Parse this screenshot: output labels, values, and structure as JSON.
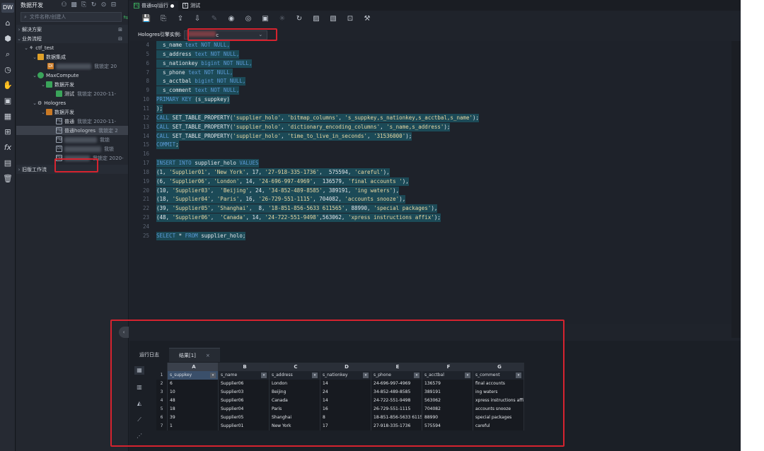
{
  "app": {
    "title": "数据开发",
    "logo_text": "DW"
  },
  "rail_icons": [
    "home-icon",
    "cube-icon",
    "search-icon",
    "clock-icon",
    "hand-icon",
    "briefcase-icon",
    "table-icon",
    "grid-icon",
    "function-icon",
    "terminal-icon",
    "trash-icon"
  ],
  "tree": {
    "search_placeholder": "文件名称/创建人",
    "items": [
      {
        "label": "解决方案",
        "meta": ""
      },
      {
        "label": "业务流程",
        "meta": ""
      },
      {
        "label": "ctf_test",
        "meta": ""
      },
      {
        "label": "数据集成",
        "meta": ""
      },
      {
        "label": "",
        "meta": "我锁定  20"
      },
      {
        "label": "MaxCompute",
        "meta": ""
      },
      {
        "label": "数据开发",
        "meta": ""
      },
      {
        "label": "测试",
        "meta": "我锁定  2020-11-"
      },
      {
        "label": "Hologres",
        "meta": ""
      },
      {
        "label": "数据开发",
        "meta": ""
      },
      {
        "label": "普通",
        "meta": "我锁定  2020-11-"
      },
      {
        "label": "普通hologres",
        "meta": "我锁定  2"
      },
      {
        "label": "",
        "meta": "我锁"
      },
      {
        "label": "",
        "meta": "我锁"
      },
      {
        "label": "",
        "meta": "我锁定  2020-"
      },
      {
        "label": "旧版工作流",
        "meta": ""
      }
    ]
  },
  "tabs": [
    {
      "label": "普通sql运行",
      "active": true
    },
    {
      "label": "测试",
      "active": false
    }
  ],
  "engine": {
    "label": "Hologres引擎实例:",
    "value": "c"
  },
  "code_lines": [
    {
      "n": "4",
      "tokens": [
        [
          "tx",
          "  s_name "
        ],
        [
          "kw",
          "text NOT NULL,"
        ]
      ],
      "hl": true
    },
    {
      "n": "5",
      "tokens": [
        [
          "tx",
          "  s_address "
        ],
        [
          "kw",
          "text NOT NULL,"
        ]
      ],
      "hl": true
    },
    {
      "n": "6",
      "tokens": [
        [
          "tx",
          "  s_nationkey "
        ],
        [
          "kw",
          "bigint NOT NULL,"
        ]
      ],
      "hl": true
    },
    {
      "n": "7",
      "tokens": [
        [
          "tx",
          "  s_phone "
        ],
        [
          "kw",
          "text NOT NULL,"
        ]
      ],
      "hl": true
    },
    {
      "n": "8",
      "tokens": [
        [
          "tx",
          "  s_acctbal "
        ],
        [
          "kw",
          "bigint NOT NULL,"
        ]
      ],
      "hl": true
    },
    {
      "n": "9",
      "tokens": [
        [
          "tx",
          "  s_comment "
        ],
        [
          "kw",
          "text NOT NULL,"
        ]
      ],
      "hl": true
    },
    {
      "n": "10",
      "tokens": [
        [
          "kw",
          "PRIMARY KEY "
        ],
        [
          "tx",
          "(s_suppkey)"
        ]
      ],
      "hl": true
    },
    {
      "n": "11",
      "tokens": [
        [
          "tx",
          ");"
        ]
      ],
      "hl": true
    },
    {
      "n": "12",
      "tokens": [
        [
          "kw",
          "CALL "
        ],
        [
          "tx",
          "SET_TABLE_PROPERTY("
        ],
        [
          "st",
          "'supplier_holo'"
        ],
        [
          "tx",
          ", "
        ],
        [
          "st",
          "'bitmap_columns'"
        ],
        [
          "tx",
          ", "
        ],
        [
          "st",
          "'s_suppkey,s_nationkey,s_acctbal,s_name'"
        ],
        [
          "tx",
          ");"
        ]
      ],
      "hl": true
    },
    {
      "n": "13",
      "tokens": [
        [
          "kw",
          "CALL "
        ],
        [
          "tx",
          "SET_TABLE_PROPERTY("
        ],
        [
          "st",
          "'supplier_holo'"
        ],
        [
          "tx",
          ", "
        ],
        [
          "st",
          "'dictionary_encoding_columns'"
        ],
        [
          "tx",
          ", "
        ],
        [
          "st",
          "'s_name,s_address'"
        ],
        [
          "tx",
          ");"
        ]
      ],
      "hl": true
    },
    {
      "n": "14",
      "tokens": [
        [
          "kw",
          "CALL "
        ],
        [
          "tx",
          "SET_TABLE_PROPERTY("
        ],
        [
          "st",
          "'supplier_holo'"
        ],
        [
          "tx",
          ", "
        ],
        [
          "st",
          "'time_to_live_in_seconds'"
        ],
        [
          "tx",
          ", "
        ],
        [
          "st",
          "'31536000'"
        ],
        [
          "tx",
          ");"
        ]
      ],
      "hl": true
    },
    {
      "n": "15",
      "tokens": [
        [
          "kw",
          "COMMIT"
        ],
        [
          "tx",
          ";"
        ]
      ],
      "hl": true
    },
    {
      "n": "16",
      "tokens": [],
      "hl": true
    },
    {
      "n": "17",
      "tokens": [
        [
          "kw",
          "INSERT INTO "
        ],
        [
          "tx",
          "supplier_holo "
        ],
        [
          "kw",
          "VALUES"
        ]
      ],
      "hl": true
    },
    {
      "n": "18",
      "tokens": [
        [
          "tx",
          "(1, "
        ],
        [
          "st",
          "'Supplier01'"
        ],
        [
          "tx",
          ", "
        ],
        [
          "st",
          "'New York'"
        ],
        [
          "tx",
          ", 17, "
        ],
        [
          "st",
          "'27-918-335-1736'"
        ],
        [
          "tx",
          ",  575594, "
        ],
        [
          "st",
          "'careful'"
        ],
        [
          "tx",
          "),"
        ]
      ],
      "hl": true
    },
    {
      "n": "19",
      "tokens": [
        [
          "tx",
          "(6, "
        ],
        [
          "st",
          "'Supplier06'"
        ],
        [
          "tx",
          ", "
        ],
        [
          "st",
          "'London'"
        ],
        [
          "tx",
          ", 14, "
        ],
        [
          "st",
          "'24-696-997-4969'"
        ],
        [
          "tx",
          ",  136579, "
        ],
        [
          "st",
          "'final accounts '"
        ],
        [
          "tx",
          "),"
        ]
      ],
      "hl": true
    },
    {
      "n": "20",
      "tokens": [
        [
          "tx",
          "(10, "
        ],
        [
          "st",
          "'Supplier03'"
        ],
        [
          "tx",
          ",  "
        ],
        [
          "st",
          "'Beijing'"
        ],
        [
          "tx",
          ", 24, "
        ],
        [
          "st",
          "'34-852-489-8585'"
        ],
        [
          "tx",
          ", 389191, "
        ],
        [
          "st",
          "'ing waters'"
        ],
        [
          "tx",
          "),"
        ]
      ],
      "hl": true
    },
    {
      "n": "21",
      "tokens": [
        [
          "tx",
          "(18, "
        ],
        [
          "st",
          "'Supplier04'"
        ],
        [
          "tx",
          ", "
        ],
        [
          "st",
          "'Paris'"
        ],
        [
          "tx",
          ", 16, "
        ],
        [
          "st",
          "'26-729-551-1115'"
        ],
        [
          "tx",
          ", 704082, "
        ],
        [
          "st",
          "'accounts snooze'"
        ],
        [
          "tx",
          "),"
        ]
      ],
      "hl": true
    },
    {
      "n": "22",
      "tokens": [
        [
          "tx",
          "(39, "
        ],
        [
          "st",
          "'Supplier05'"
        ],
        [
          "tx",
          ", "
        ],
        [
          "st",
          "'Shanghai'"
        ],
        [
          "tx",
          ",  8, "
        ],
        [
          "st",
          "'18-851-856-5633 611565'"
        ],
        [
          "tx",
          ", 88990, "
        ],
        [
          "st",
          "'special packages'"
        ],
        [
          "tx",
          "),"
        ]
      ],
      "hl": true
    },
    {
      "n": "23",
      "tokens": [
        [
          "tx",
          "(48, "
        ],
        [
          "st",
          "'Supplier06'"
        ],
        [
          "tx",
          ",  "
        ],
        [
          "st",
          "'Canada'"
        ],
        [
          "tx",
          ", 14, "
        ],
        [
          "st",
          "'24-722-551-9498'"
        ],
        [
          "tx",
          ",563062, "
        ],
        [
          "st",
          "'xpress instructions affix'"
        ],
        [
          "tx",
          ");"
        ]
      ],
      "hl": true
    },
    {
      "n": "24",
      "tokens": [],
      "hl": true
    },
    {
      "n": "25",
      "tokens": [
        [
          "kw",
          "SELECT "
        ],
        [
          "tx",
          "* "
        ],
        [
          "kw",
          "FROM "
        ],
        [
          "tx",
          "supplier_holo;"
        ]
      ],
      "hl": true
    }
  ],
  "result": {
    "tabs": [
      {
        "label": "运行日志",
        "active": false
      },
      {
        "label": "结果[1]",
        "active": true,
        "close": "×"
      }
    ],
    "col_letters": [
      "A",
      "B",
      "C",
      "D",
      "E",
      "F",
      "G"
    ],
    "columns": [
      "s_suppkey",
      "s_name",
      "s_address",
      "s_nationkey",
      "s_phone",
      "s_acctbal",
      "s_comment"
    ],
    "row_numbers": [
      "1",
      "2",
      "3",
      "4",
      "5",
      "6",
      "7"
    ],
    "rows": [
      [
        "6",
        "Supplier06",
        "London",
        "14",
        "24-696-997-4969",
        "136579",
        "final accounts"
      ],
      [
        "10",
        "Supplier03",
        "Beijing",
        "24",
        "34-852-489-8585",
        "389191",
        "ing waters"
      ],
      [
        "48",
        "Supplier06",
        "Canada",
        "14",
        "24-722-551-9498",
        "563062",
        "xpress instructions affi"
      ],
      [
        "18",
        "Supplier04",
        "Paris",
        "16",
        "26-729-551-1115",
        "704082",
        "accounts snooze"
      ],
      [
        "39",
        "Supplier05",
        "Shanghai",
        "8",
        "18-851-856-5633 6115",
        "88990",
        "special packages"
      ],
      [
        "1",
        "Supplier01",
        "New York",
        "17",
        "27-918-335-1736",
        "575594",
        "careful"
      ]
    ]
  },
  "colors": {
    "highlight": "#1c4a57",
    "keyword": "#5c9ad6",
    "string": "#e7d7a2",
    "annotation_red": "#d6232f"
  }
}
